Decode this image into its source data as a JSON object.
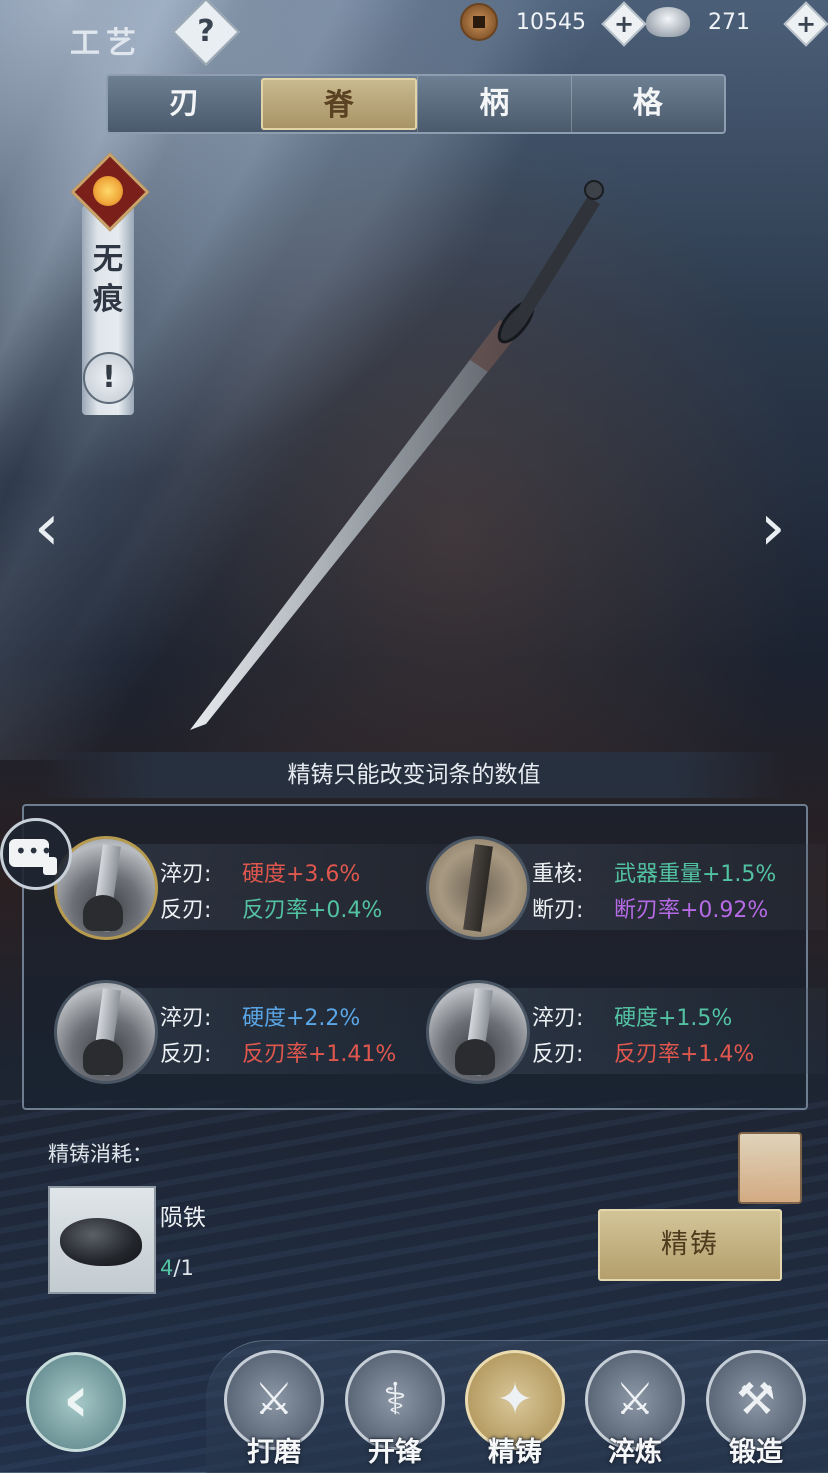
{
  "header": {
    "title": "工艺",
    "help_symbol": "?",
    "copper_amount": "10545",
    "silver_amount": "271",
    "plus_symbol": "+"
  },
  "tabs": [
    {
      "label": "刃",
      "active": false
    },
    {
      "label": "脊",
      "active": true
    },
    {
      "label": "柄",
      "active": false
    },
    {
      "label": "格",
      "active": false
    }
  ],
  "weapon": {
    "name": "无痕",
    "info_symbol": "!"
  },
  "navigation": {
    "prev_symbol": "‹",
    "next_symbol": "›"
  },
  "notice": "精铸只能改变词条的数值",
  "entries": [
    {
      "line1_label": "淬刃:",
      "line1_value": "硬度+3.6%",
      "line1_color": "#e0574e",
      "line2_label": "反刃:",
      "line2_value": "反刃率+0.4%",
      "line2_color": "#52c2a2"
    },
    {
      "line1_label": "重核:",
      "line1_value": "武器重量+1.5%",
      "line1_color": "#52c2a2",
      "line2_label": "断刃:",
      "line2_value": "断刃率+0.92%",
      "line2_color": "#b66ae6"
    },
    {
      "line1_label": "淬刃:",
      "line1_value": "硬度+2.2%",
      "line1_color": "#5aa6e6",
      "line2_label": "反刃:",
      "line2_value": "反刃率+1.41%",
      "line2_color": "#e0574e"
    },
    {
      "line1_label": "淬刃:",
      "line1_value": "硬度+1.5%",
      "line1_color": "#52c2a2",
      "line2_label": "反刃:",
      "line2_value": "反刃率+1.4%",
      "line2_color": "#e0574e"
    }
  ],
  "cost": {
    "label": "精铸消耗：",
    "material_name": "陨铁",
    "have": "4",
    "need": "/1",
    "button_label": "精铸"
  },
  "bottom_nav": {
    "back_symbol": "‹",
    "items": [
      {
        "label": "打磨",
        "icon": "grind-icon",
        "active": false
      },
      {
        "label": "开锋",
        "icon": "sharpen-icon",
        "active": false
      },
      {
        "label": "精铸",
        "icon": "refine-cast-icon",
        "active": true
      },
      {
        "label": "淬炼",
        "icon": "temper-icon",
        "active": false
      },
      {
        "label": "锻造",
        "icon": "forge-icon",
        "active": false
      }
    ]
  }
}
